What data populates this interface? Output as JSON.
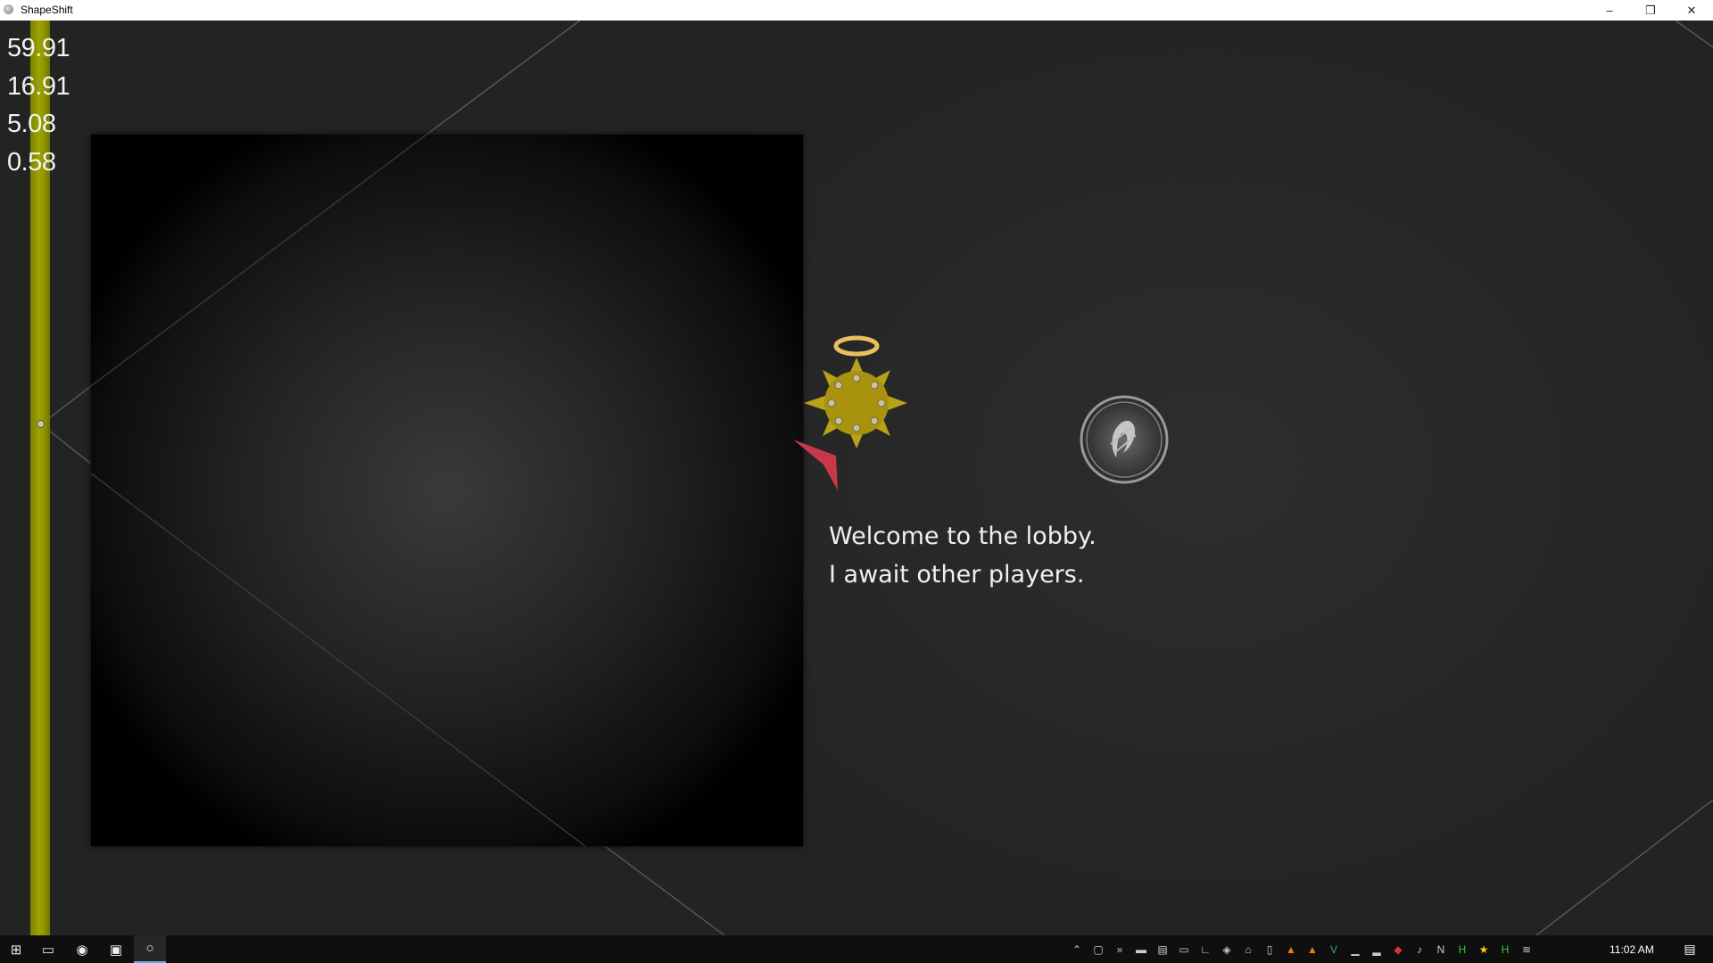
{
  "window": {
    "title": "ShapeShift",
    "controls": {
      "minimize": "–",
      "restore": "❐",
      "close": "✕"
    }
  },
  "stats": [
    "59.91",
    "16.91",
    "5.08",
    "0.58"
  ],
  "lobby": {
    "line1": "Welcome to the lobby.",
    "line2": "I await other players."
  },
  "colors": {
    "background": "#262626",
    "accent_yellow": "#9da400",
    "sun_fill": "#b8a218",
    "halo": "#e8c060",
    "pointer": "#c8374a"
  },
  "taskbar": {
    "start_icon": "windows-start-icon",
    "task_view_icon": "task-view-icon",
    "pinned": [
      "shapeshift-app-icon",
      "visual-studio-icon",
      "game-window-icon"
    ],
    "tray_icons": [
      "chevron-up-icon",
      "window-icon",
      "overflow-icon",
      "storage-icon",
      "printer-icon",
      "monitor-icon",
      "chart-icon",
      "nvidia-icon",
      "network-icon",
      "usb-icon",
      "vlc-icon",
      "vlc-icon-2",
      "v-icon",
      "bar-icon",
      "bar-icon-2",
      "speaker-icon",
      "shield-icon",
      "app-n-icon",
      "app-h-icon",
      "star-icon",
      "h-icon",
      "wifi-icon"
    ],
    "clock": "11:02 AM",
    "notification_icon": "action-center-icon"
  }
}
